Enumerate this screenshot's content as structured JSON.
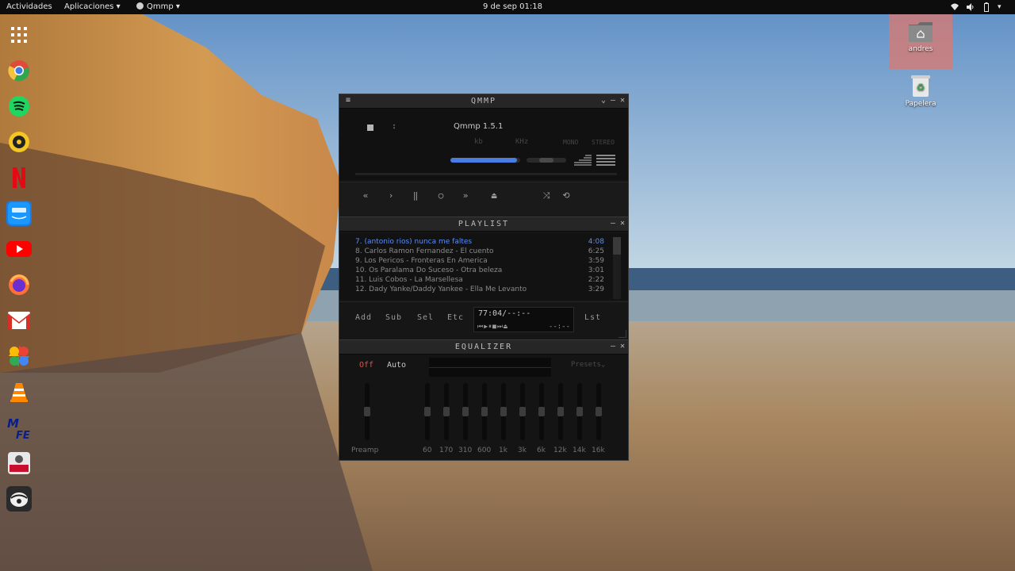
{
  "topbar": {
    "activities": "Actividades",
    "applications": "Aplicaciones ▾",
    "app_menu": "Qmmp ▾",
    "clock": "9 de sep  01:18"
  },
  "desktop": {
    "home_label": "andres",
    "trash_label": "Papelera"
  },
  "player": {
    "title": "QMMP",
    "song_title": "Qmmp 1.5.1",
    "colon": ":",
    "kb": "kb",
    "khz": "KHz",
    "mono": "MONO",
    "stereo": "STEREO",
    "volume": 0.95,
    "balance": 0.5,
    "controls": [
      "«",
      "›",
      "‖",
      "○",
      "»",
      "⏏",
      "⤨",
      "⟲"
    ]
  },
  "playlist": {
    "title": "PLAYLIST",
    "items": [
      {
        "title": "7. (antonio rios) nunca me faltes",
        "duration": "4:08",
        "active": true
      },
      {
        "title": "8. Carlos Ramon Fernandez - El cuento",
        "duration": "6:25",
        "active": false
      },
      {
        "title": "9. Los Pericos - Fronteras En America",
        "duration": "3:59",
        "active": false
      },
      {
        "title": "10. Os Paralama Do Suceso - Otra beleza",
        "duration": "3:01",
        "active": false
      },
      {
        "title": "11. Luis Cobos - La Marsellesa",
        "duration": "2:22",
        "active": false
      },
      {
        "title": "12. Dady Yanke/Daddy Yankee - Ella Me Levanto",
        "duration": "3:29",
        "active": false
      }
    ],
    "buttons": {
      "add": "Add",
      "sub": "Sub",
      "sel": "Sel",
      "etc": "Etc",
      "lst": "Lst"
    },
    "time_display": "77:04/--:--",
    "time_small": "--:--"
  },
  "equalizer": {
    "title": "EQUALIZER",
    "off": "Off",
    "auto": "Auto",
    "presets": "Presets⌄",
    "preamp": "Preamp",
    "bands": [
      "60",
      "170",
      "310",
      "600",
      "1k",
      "3k",
      "6k",
      "12k",
      "14k",
      "16k"
    ]
  },
  "colors": {
    "accent": "#5d8df5",
    "off_red": "#e0504a",
    "volume_blue": "#4a7de0"
  }
}
